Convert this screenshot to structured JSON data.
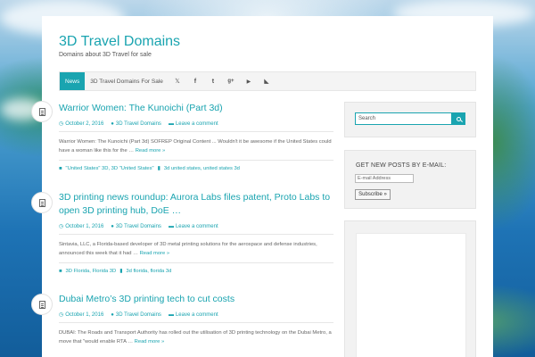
{
  "site": {
    "title": "3D Travel Domains",
    "description": "Domains about 3D Travel for sale"
  },
  "nav": {
    "items": [
      "News",
      "3D Travel Domains For Sale"
    ],
    "social_icons": [
      "twitter-icon",
      "facebook-icon",
      "tumblr-icon",
      "google-plus-icon",
      "youtube-icon",
      "rss-icon"
    ]
  },
  "posts": [
    {
      "title": "Warrior Women: The Kunoichi (Part 3d)",
      "date": "October 2, 2016",
      "author": "3D Travel Domains",
      "comment": "Leave a comment",
      "excerpt": "Warrior Women: The Kunoichi (Part 3d) SOFREP Original Content ... Wouldn't it be awesome if the United States could have a woman like this for the …",
      "read_more": "Read more »",
      "categories": "\"United States\" 3D, 3D \"United States\"",
      "tags": "3d united states, united states 3d"
    },
    {
      "title": "3D printing news roundup: Aurora Labs files patent, Proto Labs to open 3D printing hub, DoE …",
      "date": "October 1, 2016",
      "author": "3D Travel Domains",
      "comment": "Leave a comment",
      "excerpt": "Sintavia, LLC, a Florida-based developer of 3D metal printing solutions for the aerospace and defense industries, announced this week that it had …",
      "read_more": "Read more »",
      "categories": "3D Florida, Florida 3D",
      "tags": "3d florida, florida 3d"
    },
    {
      "title": "Dubai Metro’s 3D printing tech to cut costs",
      "date": "October 1, 2016",
      "author": "3D Travel Domains",
      "comment": "Leave a comment",
      "excerpt": "DUBAI: The Roads and Transport Authority has rolled out the utilisation of 3D printing technology on the Dubai Metro, a move that \"would enable RTA …",
      "read_more": "Read more »"
    }
  ],
  "sidebar": {
    "search_placeholder": "Search",
    "subscribe_title": "GET NEW POSTS BY E-MAIL:",
    "email_placeholder": "E-mail Address",
    "subscribe_label": "Subscribe »"
  },
  "colors": {
    "accent": "#1aa4b0"
  }
}
